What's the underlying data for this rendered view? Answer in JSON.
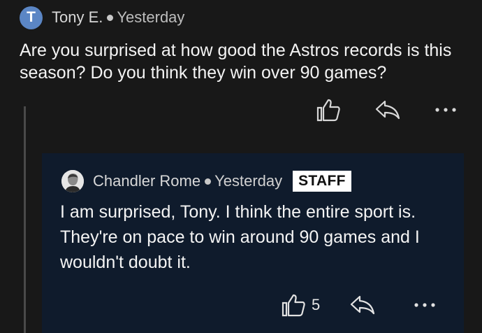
{
  "comment": {
    "avatar_initial": "T",
    "author": "Tony E.",
    "timestamp": "Yesterday",
    "body": "Are you surprised at how good the Astros records is this season? Do you think they win over 90 games?",
    "actions": {
      "like_icon": "thumbs-up-icon",
      "reply_icon": "reply-arrow-icon",
      "more_icon": "more-dots-icon"
    }
  },
  "reply": {
    "author": "Chandler Rome",
    "timestamp": "Yesterday",
    "badge": "STAFF",
    "body": "I am surprised, Tony. I think the entire sport is. They're on pace to win around 90 games and I wouldn't doubt it.",
    "like_count": "5",
    "actions": {
      "like_icon": "thumbs-up-icon",
      "reply_icon": "reply-arrow-icon",
      "more_icon": "more-dots-icon"
    }
  },
  "colors": {
    "background": "#181818",
    "reply_background": "#0f1b2c",
    "avatar_blue": "#5b86c5",
    "badge_background": "#ffffff"
  }
}
